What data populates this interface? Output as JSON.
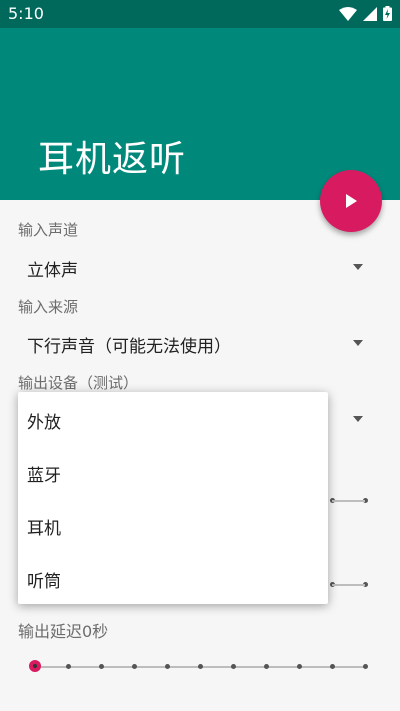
{
  "status_bar": {
    "time": "5:10",
    "icons": [
      "wifi-icon",
      "signal-icon",
      "battery-charging-icon"
    ]
  },
  "app_bar": {
    "title": "耳机返听"
  },
  "fab": {
    "icon": "play-icon"
  },
  "settings": {
    "input_channel": {
      "label": "输入声道",
      "value": "立体声"
    },
    "input_source": {
      "label": "输入来源",
      "value": "下行声音（可能无法使用）"
    },
    "output_device": {
      "label": "输出设备（测试）"
    },
    "output_delay": {
      "label": "输出延迟0秒",
      "slider": {
        "steps": 11,
        "selected_index": 0
      }
    }
  },
  "dropdown_popup": {
    "options": [
      "外放",
      "蓝牙",
      "耳机",
      "听筒"
    ]
  },
  "colors": {
    "primary": "#00897b",
    "primary_dark": "#00695c",
    "accent": "#d81b60"
  }
}
